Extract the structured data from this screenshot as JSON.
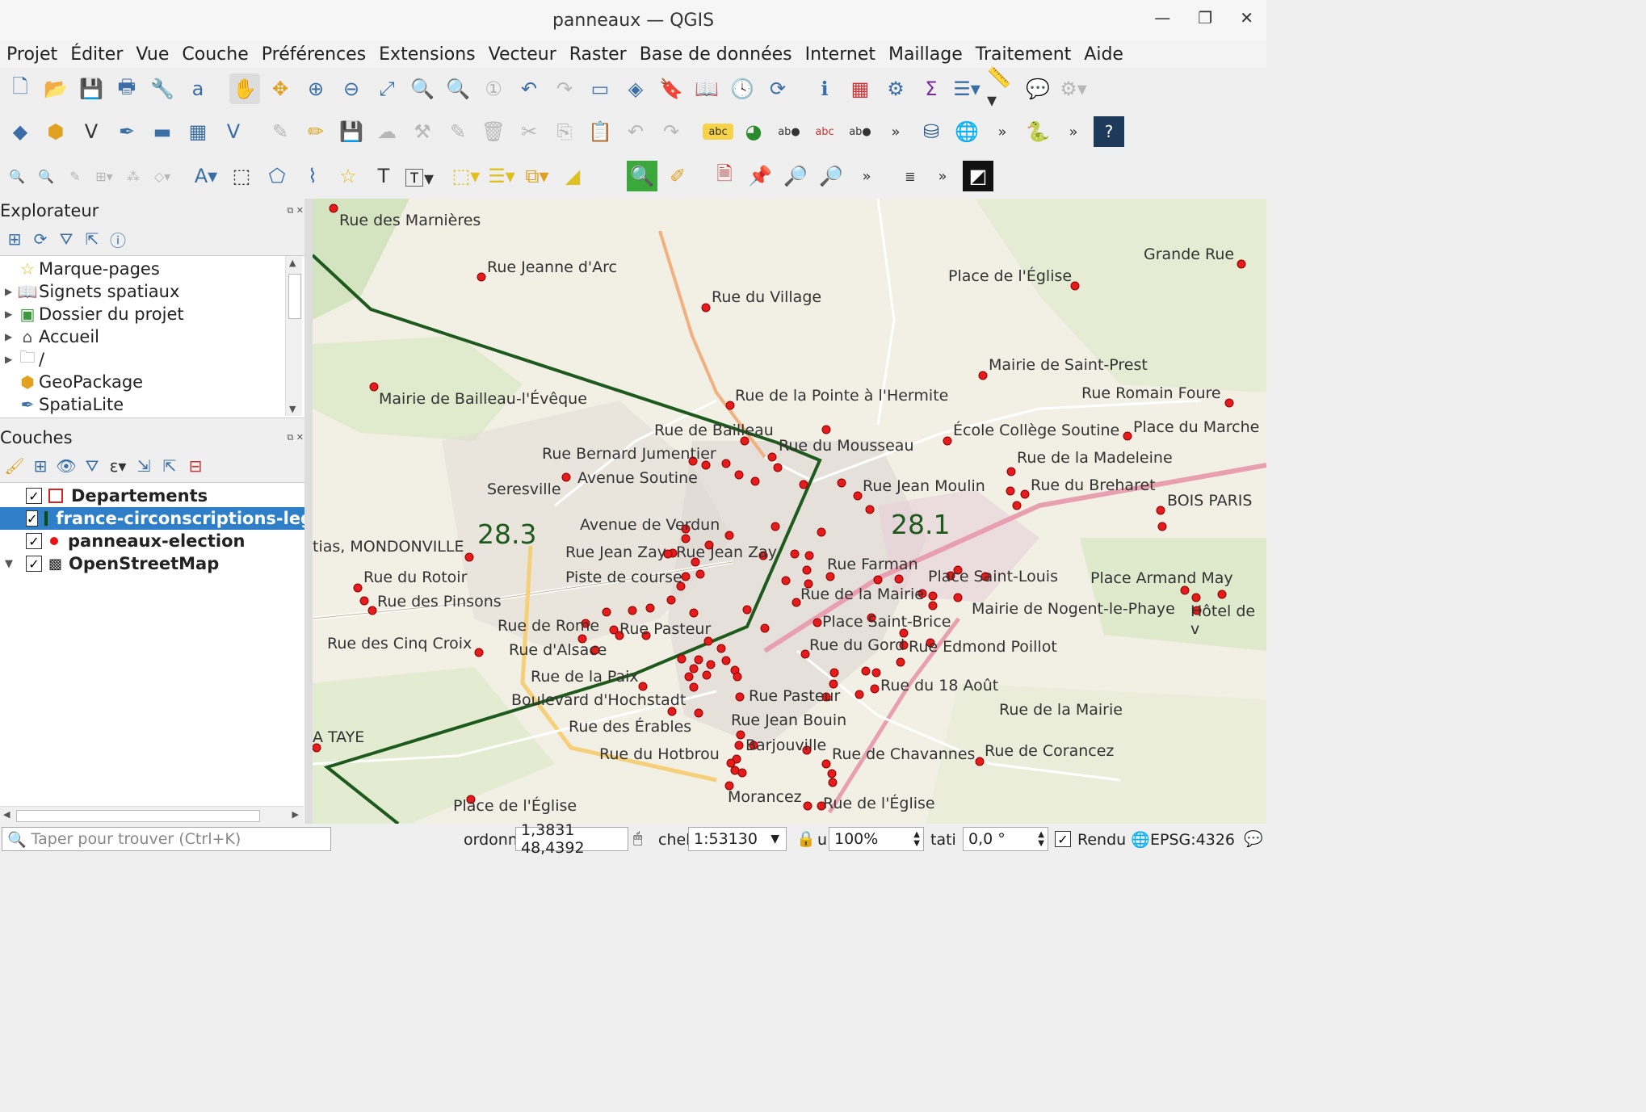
{
  "window": {
    "title": "panneaux — QGIS",
    "minimize": "—",
    "restore": "❐",
    "close": "✕"
  },
  "menu": [
    "Projet",
    "Éditer",
    "Vue",
    "Couche",
    "Préférences",
    "Extensions",
    "Vecteur",
    "Raster",
    "Base de données",
    "Internet",
    "Maillage",
    "Traitement",
    "Aide"
  ],
  "toolbars": {
    "row1": [
      "new-project-icon",
      "open-project-icon",
      "save-project-icon",
      "new-print-layout-icon",
      "style-manager-icon",
      "measure-style-icon",
      "pan-icon",
      "pan-to-selection-icon",
      "zoom-in-icon",
      "zoom-out-icon",
      "zoom-full-icon",
      "zoom-to-selection-icon",
      "zoom-to-layer-icon",
      "zoom-native-icon",
      "zoom-last-icon",
      "zoom-next-icon",
      "new-map-view-icon",
      "new-3d-view-icon",
      "new-bookmark-icon",
      "show-bookmarks-icon",
      "temporal-controller-icon",
      "refresh-icon",
      "identify-icon",
      "attribute-table-icon",
      "settings-icon",
      "statistics-icon",
      "open-table-icon",
      "measure-icon",
      "annotation-icon",
      "processing-icon"
    ],
    "row2": [
      "data-source-manager-icon",
      "add-geopackage-icon",
      "new-shapefile-icon",
      "digitize-icon",
      "new-virtual-layer-icon",
      "add-raster-icon",
      "add-mesh-icon",
      "current-edits-icon",
      "toggle-editing-icon",
      "save-edits-icon",
      "vertex-tool-icon",
      "digitize-dim-icon",
      "attribute-dim-icon",
      "delete-icon",
      "cut-icon",
      "copy-icon",
      "paste-icon",
      "undo-icon",
      "redo-icon",
      "label-abc-icon",
      "diagram-icon",
      "label-pin-icon",
      "label-rotate-icon",
      "label-move-icon",
      "more-icon",
      "database-icon",
      "web-icon",
      "more-icon-2",
      "python-icon",
      "more-icon-3",
      "help-icon"
    ],
    "row3": [
      "gps-icon",
      "gps-track-icon",
      "advanced-dig-icon",
      "advanced-2-icon",
      "advanced-3-icon",
      "advanced-4-icon",
      "text-annotation-icon",
      "select-icon",
      "add-polygon-icon",
      "add-line-icon",
      "star-icon",
      "text-tool-icon",
      "text-box-icon",
      "select-features-icon",
      "select-by-value-icon",
      "deselect-icon",
      "select-location-icon",
      "locator-icon",
      "plugin-icon",
      "layout-icon",
      "pin-icon",
      "zoom-tool-icon",
      "zoom-tool-2-icon",
      "more-icon-4",
      "plugin-more-icon",
      "more-icon-5",
      "user-icon"
    ]
  },
  "browser": {
    "title": "Explorateur",
    "items": [
      {
        "label": "Marque-pages",
        "expandable": false,
        "icon": "star-icon"
      },
      {
        "label": "Signets spatiaux",
        "expandable": true,
        "icon": "bookmark-icon"
      },
      {
        "label": "Dossier du projet",
        "expandable": true,
        "icon": "project-folder-icon"
      },
      {
        "label": "Accueil",
        "expandable": true,
        "icon": "home-icon"
      },
      {
        "label": "/",
        "expandable": true,
        "icon": "folder-icon"
      },
      {
        "label": "GeoPackage",
        "expandable": false,
        "icon": "geopackage-icon"
      },
      {
        "label": "SpatiaLite",
        "expandable": false,
        "icon": "spatialite-icon"
      }
    ]
  },
  "layers": {
    "title": "Couches",
    "items": [
      {
        "label": "Departements",
        "checked": true,
        "icon": "polygon-red-icon"
      },
      {
        "label": "france-circonscriptions-legislatives",
        "checked": true,
        "icon": "polygon-green-icon",
        "selected": true
      },
      {
        "label": "panneaux-election",
        "checked": true,
        "icon": "point-red-icon"
      },
      {
        "label": "OpenStreetMap",
        "checked": true,
        "icon": "raster-tile-icon"
      }
    ]
  },
  "map": {
    "labels": [
      "Rue des Marnières",
      "Rue Jeanne d'Arc",
      "Rue du Village",
      "Place de l'Église",
      "Grande Rue",
      "Mairie de Saint-Prest",
      "Rue Romain Foure",
      "Mairie de Bailleau-l'Évêque",
      "Rue de la Pointe à l'Hermite",
      "École Collège Soutine",
      "Place du Marche",
      "Rue de Bailleau",
      "Rue du Mousseau",
      "Rue de la Madeleine",
      "Rue Bernard Jumentier",
      "Avenue Soutine",
      "Rue Jean Moulin",
      "Rue du Breharet",
      "Seresville",
      "BOIS PARIS",
      "Avenue de Verdun",
      "28.3",
      "28.1",
      "tias, MONDONVILLE",
      "Rue Jean Zay",
      "Rue Jean Zay",
      "Rue Farman",
      "Place Saint-Louis",
      "Place Armand May",
      "Rue du Rotoir",
      "Piste de course",
      "Rue de la Mairie",
      "Mairie de Nogent-le-Phaye",
      "Hôtel de v",
      "Rue des Pinsons",
      "Place Saint-Brice",
      "Rue de Rome",
      "Rue Pasteur",
      "Rue des Cinq Croix",
      "Rue du Gord",
      "Rue Edmond Poillot",
      "Rue d'Alsace",
      "Rue de la Paix",
      "Rue du 18 Août",
      "Boulevard d'Hochstadt",
      "Rue Pasteur",
      "Rue de la Mairie",
      "Rue Jean Bouin",
      "A TAYE",
      "Rue des Érables",
      "Barjouville",
      "Rue du Hotbrou",
      "Rue de Chavannes",
      "Rue de Corancez",
      "Morancez",
      "Rue de l'Église",
      "Place de l'Église"
    ]
  },
  "status": {
    "search_placeholder": "Taper pour trouver (Ctrl+K)",
    "coord_label": "ordonn",
    "coord_value": "1,3831 48,4392",
    "scale_label": "chel",
    "scale_value": "1:53130",
    "mag_label": "u",
    "mag_value": "100%",
    "rot_label": "tati",
    "rot_value": "0,0 °",
    "render_label": "Rendu",
    "crs": "EPSG:4326"
  }
}
